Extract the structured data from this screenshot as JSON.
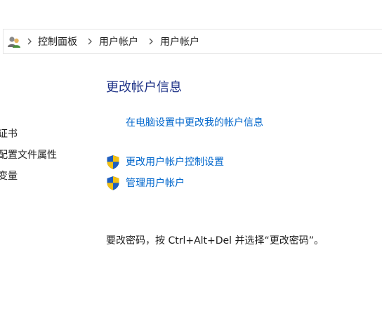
{
  "breadcrumb": {
    "icon": "user-accounts-icon",
    "items": [
      {
        "label": "控制面板"
      },
      {
        "label": "用户帐户"
      },
      {
        "label": "用户帐户"
      }
    ]
  },
  "left_pane": {
    "items": [
      {
        "label": "证书"
      },
      {
        "label": "配置文件属性"
      },
      {
        "label": "变量"
      }
    ]
  },
  "main": {
    "title": "更改帐户信息",
    "pc_settings_link": "在电脑设置中更改我的帐户信息",
    "uac_link": "更改用户帐户控制设置",
    "manage_link": "管理用户帐户",
    "password_note": "要改密码，按 Ctrl+Alt+Del 并选择“更改密码”。"
  },
  "colors": {
    "title": "#1e3287",
    "link": "#0066cc",
    "text": "#1e1e1e"
  }
}
